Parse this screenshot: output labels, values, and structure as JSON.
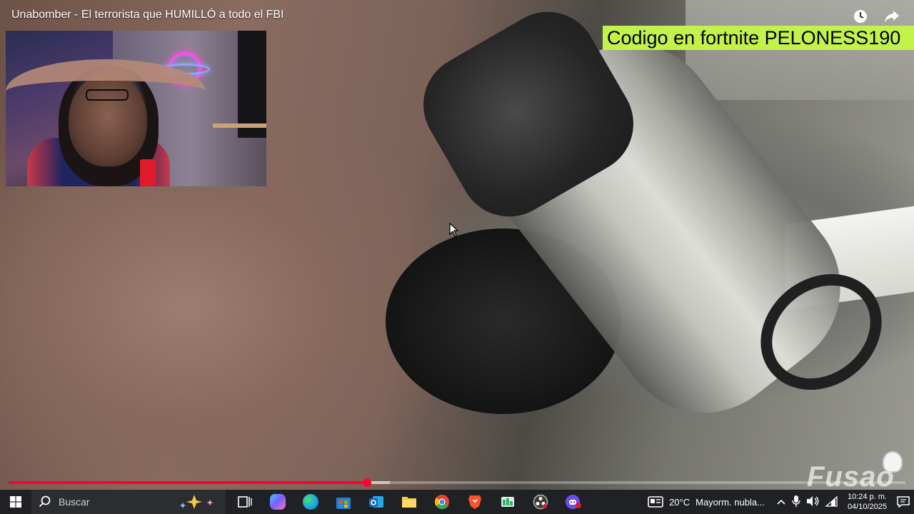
{
  "video": {
    "title": "Unabomber - El terrorista que HUMILLÓ a todo el FBI",
    "promo_text": "Codigo en fortnite PELONESS190",
    "watermark": "Fusao",
    "progress": {
      "played_fraction": 0.4,
      "buffered_fraction": 0.425
    },
    "top_icons": [
      "watch-later-icon",
      "share-icon"
    ]
  },
  "taskbar": {
    "search_placeholder": "Buscar",
    "apps": [
      {
        "name": "task-view",
        "color": "#ffffff"
      },
      {
        "name": "copilot",
        "color": "#7b5cff"
      },
      {
        "name": "edge",
        "color": "#1aa3e8"
      },
      {
        "name": "microsoft-store",
        "color": "#2b7cd3"
      },
      {
        "name": "outlook",
        "color": "#0f6cbd"
      },
      {
        "name": "file-explorer",
        "color": "#f2c94c"
      },
      {
        "name": "chrome",
        "color": "#34a853"
      },
      {
        "name": "brave",
        "color": "#fb542b"
      },
      {
        "name": "chat-app",
        "color": "#2fb66a"
      },
      {
        "name": "obs",
        "color": "#6b6b6b"
      },
      {
        "name": "discord",
        "color": "#6b4cf0"
      }
    ],
    "weather": {
      "temp": "20°C",
      "condition": "Mayorm. nubla..."
    },
    "clock": {
      "time": "10:24 p. m.",
      "date": "04/10/2025"
    }
  }
}
